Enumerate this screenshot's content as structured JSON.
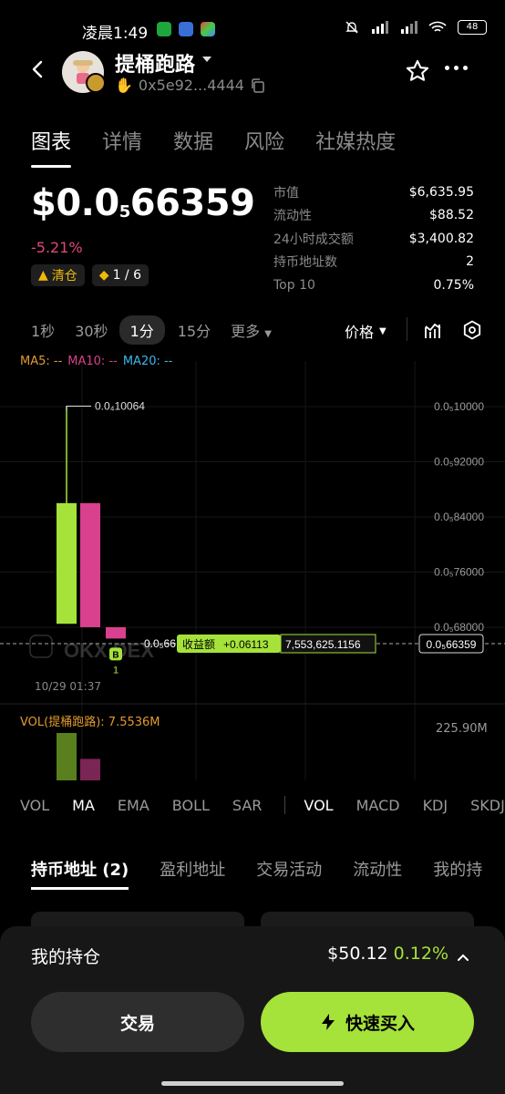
{
  "status_bar": {
    "time": "凌晨1:49",
    "battery": "48"
  },
  "header": {
    "title": "提桶跑路",
    "address": "0x5e92...4444"
  },
  "main_tabs": [
    "图表",
    "详情",
    "数据",
    "风险",
    "社媒热度"
  ],
  "price": {
    "prefix": "$0.0",
    "sub_zeros": "5",
    "digits": "66359",
    "change": "-5.21%",
    "tag_clear": "清仓",
    "tag_ratio": "1 / 6"
  },
  "stats": [
    {
      "label": "市值",
      "value": "$6,635.95"
    },
    {
      "label": "流动性",
      "value": "$88.52"
    },
    {
      "label": "24小时成交额",
      "value": "$3,400.82"
    },
    {
      "label": "持币地址数",
      "value": "2"
    },
    {
      "label": "Top 10",
      "value": "0.75%"
    }
  ],
  "intervals": [
    "1秒",
    "30秒",
    "1分",
    "15分",
    "更多"
  ],
  "price_toggle": "价格",
  "ma_legend": {
    "ma5": "MA5: --",
    "ma10": "MA10: --",
    "ma20": "MA20: --"
  },
  "chart_data": {
    "type": "candlestick",
    "y_ticks": [
      "0.0₅10000",
      "0.0₅92000",
      "0.0₅84000",
      "0.0₅76000",
      "0.0₅68000"
    ],
    "y_tick_values": [
      1e-05,
      9.2e-06,
      8.4e-06,
      7.6e-06,
      6.8e-06
    ],
    "candles": [
      {
        "open": 6.85e-06,
        "close": 8.6e-06,
        "high": 1.00064e-05,
        "low": 6.85e-06
      },
      {
        "open": 8.6e-06,
        "close": 6.8e-06,
        "high": 8.6e-06,
        "low": 6.8e-06
      },
      {
        "open": 6.8e-06,
        "close": 6.6359e-06,
        "high": 6.8e-06,
        "low": 6.6359e-06
      }
    ],
    "volumes": [
      7.5,
      3.7,
      0.3
    ],
    "max_label": "0.0₄10064",
    "current_price": "0.0₅66359",
    "current_left": "0.0₅66",
    "pnl_label": "收益额",
    "pnl_value": "+0.06113",
    "position_amount": "7,553,625.1156",
    "buy_marker": "B",
    "buy_count": "1",
    "watermark": "OKX DEX",
    "x_label": "10/29 01:37",
    "vol_legend": "VOL(提桶跑路): 7.5536M",
    "vol_axis": "225.90M",
    "colors": {
      "up": "#a5e23a",
      "down": "#d9408d"
    }
  },
  "indicators_left": [
    "VOL",
    "MA",
    "EMA",
    "BOLL",
    "SAR"
  ],
  "indicators_right": [
    "VOL",
    "MACD",
    "KDJ",
    "SKDJ"
  ],
  "bottom_tabs": [
    "持币地址 (2)",
    "盈利地址",
    "交易活动",
    "流动性",
    "我的持"
  ],
  "holding": {
    "label": "我的持仓",
    "value": "$50.12",
    "pct": "0.12%"
  },
  "buttons": {
    "trade": "交易",
    "quick_buy": "快速买入"
  }
}
